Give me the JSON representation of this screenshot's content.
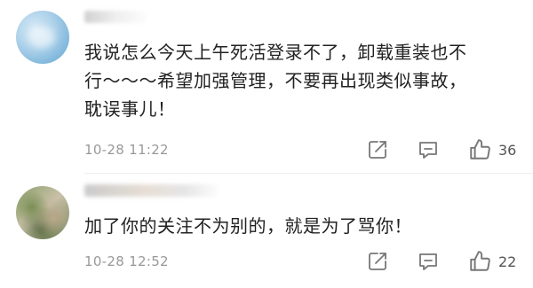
{
  "comments": [
    {
      "username": "",
      "text_lines": [
        "我说怎么今天上午死活登录不了，卸载重装也不",
        "行～～～希望加强管理，不要再出现类似事故，",
        "耽误事儿！"
      ],
      "time": "10-28 11:22",
      "likes": "36"
    },
    {
      "username": "",
      "text_lines": [
        "加了你的关注不为别的，就是为了骂你！"
      ],
      "time": "10-28 12:52",
      "likes": "22"
    }
  ],
  "icons": {
    "share": "share-icon",
    "reply": "comment-icon",
    "like": "thumbs-up-icon"
  },
  "colors": {
    "text": "#222222",
    "meta": "#999999",
    "icon": "#777777"
  }
}
